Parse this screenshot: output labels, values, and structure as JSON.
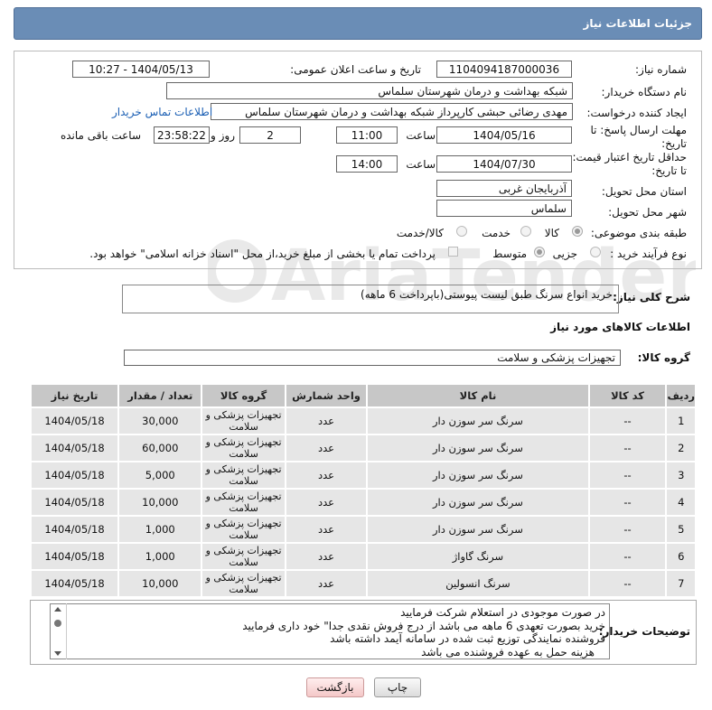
{
  "header": {
    "title": "جزئیات اطلاعات نیاز"
  },
  "fields": {
    "need_number_label": "شماره نیاز:",
    "need_number": "1104094187000036",
    "announce_label": "تاریخ و ساعت اعلان عمومی:",
    "announce_value": "1404/05/13 - 10:27",
    "buyer_org_label": "نام دستگاه خریدار:",
    "buyer_org": "شبکه بهداشت و درمان  شهرستان سلماس",
    "creator_label": "ایجاد کننده درخواست:",
    "creator": "مهدی رضائی حبشی کارپرداز شبکه بهداشت و درمان  شهرستان سلماس",
    "contact_link": "اطلاعات تماس خریدار",
    "deadline_label_1": "مهلت ارسال پاسخ: تا",
    "deadline_label_2": "تاریخ:",
    "deadline_date": "1404/05/16",
    "time_label": "ساعت",
    "deadline_time": "11:00",
    "days_value": "2",
    "days_label": "روز و",
    "remaining_time": "23:58:22",
    "remaining_label": "ساعت باقی مانده",
    "validity_label_1": "حداقل تاریخ اعتبار قیمت:",
    "validity_label_2": "تا تاریخ:",
    "validity_date": "1404/07/30",
    "validity_time": "14:00",
    "province_label": "استان محل تحویل:",
    "province": "آذربایجان غربی",
    "city_label": "شهر محل تحویل:",
    "city": "سلماس",
    "category_label": "طبقه بندی موضوعی:",
    "cat_goods": "کالا",
    "cat_service": "خدمت",
    "cat_both": "کالا/خدمت",
    "process_label": "نوع فرآیند خرید :",
    "proc_partial": "جزیی",
    "proc_medium": "متوسط",
    "payment_note": "پرداخت تمام یا بخشی از مبلغ خرید،از محل \"اسناد خزانه اسلامی\" خواهد بود."
  },
  "summary": {
    "label": "شرح کلی نیاز:",
    "text": "خرید انواع سرنگ طبق لیست پیوستی(باپرداخت 6 ماهه)"
  },
  "goods": {
    "section_title": "اطلاعات کالاهای مورد نیاز",
    "group_label": "گروه کالا:",
    "group_value": "تجهیزات پزشکی و سلامت",
    "headers": [
      "ردیف",
      "کد کالا",
      "نام کالا",
      "واحد شمارش",
      "گروه کالا",
      "تعداد / مقدار",
      "تاریخ نیاز"
    ],
    "rows": [
      {
        "idx": "1",
        "code": "--",
        "name": "سرنگ سر سوزن دار",
        "unit": "عدد",
        "group": "تجهیزات پزشکی و سلامت",
        "qty": "30,000",
        "date": "1404/05/18"
      },
      {
        "idx": "2",
        "code": "--",
        "name": "سرنگ سر سوزن دار",
        "unit": "عدد",
        "group": "تجهیزات پزشکی و سلامت",
        "qty": "60,000",
        "date": "1404/05/18"
      },
      {
        "idx": "3",
        "code": "--",
        "name": "سرنگ سر سوزن دار",
        "unit": "عدد",
        "group": "تجهیزات پزشکی و سلامت",
        "qty": "5,000",
        "date": "1404/05/18"
      },
      {
        "idx": "4",
        "code": "--",
        "name": "سرنگ سر سوزن دار",
        "unit": "عدد",
        "group": "تجهیزات پزشکی و سلامت",
        "qty": "10,000",
        "date": "1404/05/18"
      },
      {
        "idx": "5",
        "code": "--",
        "name": "سرنگ سر سوزن دار",
        "unit": "عدد",
        "group": "تجهیزات پزشکی و سلامت",
        "qty": "1,000",
        "date": "1404/05/18"
      },
      {
        "idx": "6",
        "code": "--",
        "name": "سرنگ گاواژ",
        "unit": "عدد",
        "group": "تجهیزات پزشکی و سلامت",
        "qty": "1,000",
        "date": "1404/05/18"
      },
      {
        "idx": "7",
        "code": "--",
        "name": "سرنگ انسولین",
        "unit": "عدد",
        "group": "تجهیزات پزشکی و سلامت",
        "qty": "10,000",
        "date": "1404/05/18"
      }
    ]
  },
  "notes": {
    "label": "توضیحات خریدار:",
    "lines": [
      "در صورت موجودی در استعلام شرکت فرمایید",
      "خرید بصورت تعهدی 6 ماهه می باشد از درج فروش نقدی جدا\" خود داری فرمایید",
      "فروشنده نمایندگی توزیع ثبت شده در سامانه آیمد داشته باشد",
      "هزینه حمل به عهده فروشنده می باشد"
    ]
  },
  "buttons": {
    "print": "چاپ",
    "back": "بازگشت"
  },
  "watermark": {
    "text": "AriaTender.neT"
  }
}
